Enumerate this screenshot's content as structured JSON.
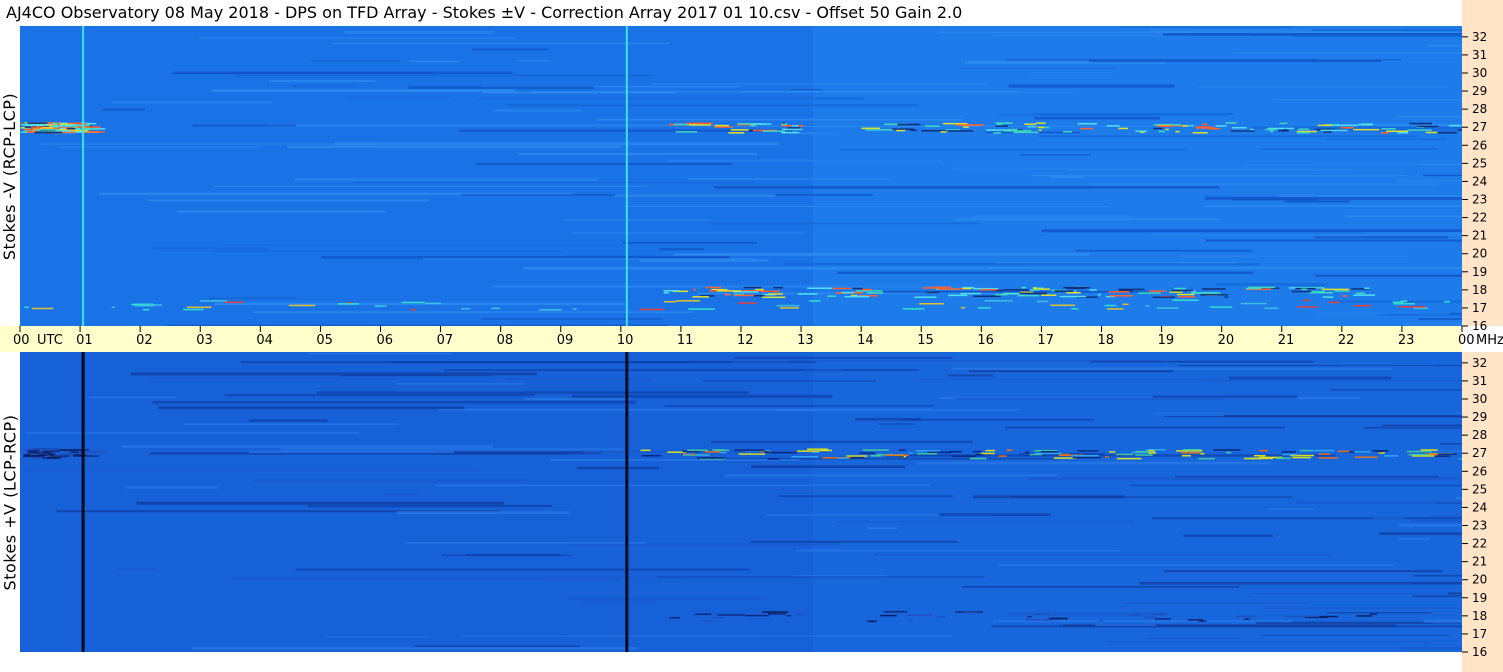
{
  "header": {
    "title": "AJ4CO Observatory  08 May 2018  -  DPS on TFD Array  -  Stokes ±V  -  Correction Array 2017 01 10.csv  -  Offset 50  Gain 2.0"
  },
  "panels": {
    "top_label": "Stokes -V (RCP-LCP)",
    "bottom_label": "Stokes +V (LCP-RCP)"
  },
  "time_axis": {
    "utc_label": "UTC",
    "unit_label": "MHz"
  },
  "colors": {
    "base": "#1a73e6",
    "axis_freq_bg": "#ffe4c8",
    "axis_time_bg": "#ffffcc"
  },
  "chart_data": [
    {
      "type": "heatmap",
      "name": "Stokes -V (RCP-LCP)",
      "x_label": "UTC",
      "y_label": "MHz",
      "x_ticks": [
        "00",
        "01",
        "02",
        "03",
        "04",
        "05",
        "06",
        "07",
        "08",
        "09",
        "10",
        "11",
        "12",
        "13",
        "14",
        "15",
        "16",
        "17",
        "18",
        "19",
        "20",
        "21",
        "22",
        "23",
        "00"
      ],
      "y_ticks": [
        16,
        17,
        18,
        19,
        20,
        21,
        22,
        23,
        24,
        25,
        26,
        27,
        28,
        29,
        30,
        31,
        32
      ],
      "xlim": [
        0,
        24
      ],
      "ylim": [
        16,
        32.6
      ],
      "vertical_lines_utc": [
        1.05,
        10.1
      ],
      "vertical_line_style": "bright",
      "features": [
        {
          "band_mhz": 27.0,
          "utc_range": [
            0,
            1.0
          ],
          "intensity": "high"
        },
        {
          "band_mhz": 27.0,
          "utc_range": [
            10.3,
            24
          ],
          "intensity": "high"
        },
        {
          "band_mhz": 17.9,
          "utc_range": [
            10.5,
            22.5
          ],
          "intensity": "high"
        },
        {
          "band_mhz": 17.2,
          "utc_range": [
            0,
            24
          ],
          "intensity": "medium"
        }
      ]
    },
    {
      "type": "heatmap",
      "name": "Stokes +V (LCP-RCP)",
      "x_label": "UTC",
      "y_label": "MHz",
      "x_ticks": [
        "00",
        "01",
        "02",
        "03",
        "04",
        "05",
        "06",
        "07",
        "08",
        "09",
        "10",
        "11",
        "12",
        "13",
        "14",
        "15",
        "16",
        "17",
        "18",
        "19",
        "20",
        "21",
        "22",
        "23",
        "00"
      ],
      "y_ticks": [
        16,
        17,
        18,
        19,
        20,
        21,
        22,
        23,
        24,
        25,
        26,
        27,
        28,
        29,
        30,
        31,
        32
      ],
      "xlim": [
        0,
        24
      ],
      "ylim": [
        16,
        32.6
      ],
      "vertical_lines_utc": [
        1.05,
        10.1
      ],
      "vertical_line_style": "dark",
      "features": [
        {
          "band_mhz": 27.0,
          "utc_range": [
            10.3,
            24
          ],
          "intensity": "high"
        },
        {
          "band_mhz": 18.0,
          "utc_range": [
            10.5,
            22.5
          ],
          "intensity": "low"
        },
        {
          "band_mhz": 27.0,
          "utc_range": [
            0,
            1.0
          ],
          "intensity": "low"
        }
      ]
    }
  ]
}
